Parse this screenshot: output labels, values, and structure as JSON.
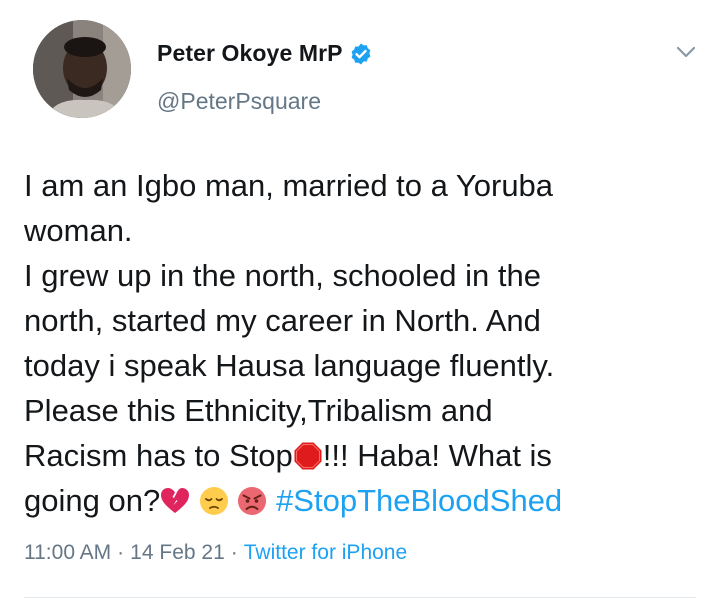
{
  "author": {
    "display_name": "Peter Okoye MrP",
    "handle": "@PeterPsquare",
    "verified": true
  },
  "tweet": {
    "lines": [
      "I am an Igbo man, married to a Yoruba",
      "woman.",
      "I grew up in the north, schooled in the",
      "north, started my career in North. And",
      "today i speak Hausa language fluently.",
      "Please this Ethnicity,Tribalism and"
    ],
    "line7_before_emoji": "Racism has to Stop",
    "line7_after_emoji": "!!! Haba! What is",
    "line8_start": "going on?",
    "hashtag": "#StopTheBloodShed",
    "emojis": [
      "stop-sign-emoji",
      "broken-heart-emoji",
      "pensive-face-emoji",
      "angry-face-emoji"
    ]
  },
  "meta": {
    "time": "11:00 AM",
    "date": "14 Feb 21",
    "separator": "·",
    "source": "Twitter for iPhone"
  },
  "icons": {
    "verified": "verified-badge-icon",
    "caret": "chevron-down-icon"
  },
  "colors": {
    "brand_blue": "#1da1f2",
    "secondary_text": "#657786",
    "primary_text": "#14171a"
  }
}
